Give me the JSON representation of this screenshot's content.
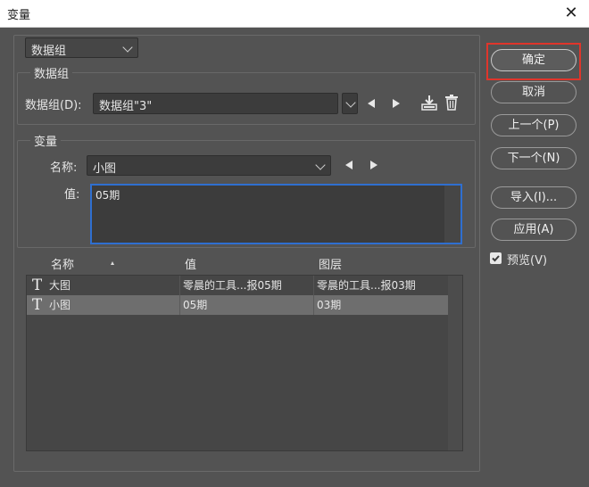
{
  "window": {
    "title": "变量",
    "close_icon": "close-icon"
  },
  "mode_select": {
    "value": "数据组"
  },
  "dataset_group": {
    "legend": "数据组",
    "label": "数据组(D):",
    "value": "数据组\"3\""
  },
  "variable_group": {
    "legend": "变量",
    "name_label": "名称:",
    "name_value": "小图",
    "value_label": "值:",
    "value_text": "05期"
  },
  "table": {
    "headers": [
      "名称",
      "值",
      "图层"
    ],
    "rows": [
      {
        "name": "大图",
        "value": "零晨的工具...报05期",
        "layer": "零晨的工具...报03期",
        "selected": false
      },
      {
        "name": "小图",
        "value": "05期",
        "layer": "03期",
        "selected": true
      }
    ]
  },
  "buttons": {
    "ok": "确定",
    "cancel": "取消",
    "prev": "上一个(P)",
    "next": "下一个(N)",
    "import": "导入(I)...",
    "apply": "应用(A)"
  },
  "preview": {
    "label": "预览(V)",
    "checked": true
  },
  "colors": {
    "panel": "#535353",
    "field": "#3c3c3c",
    "focus_border": "#2f6fd0",
    "highlight": "#e0352b",
    "selected_row": "#6e6e6e"
  }
}
